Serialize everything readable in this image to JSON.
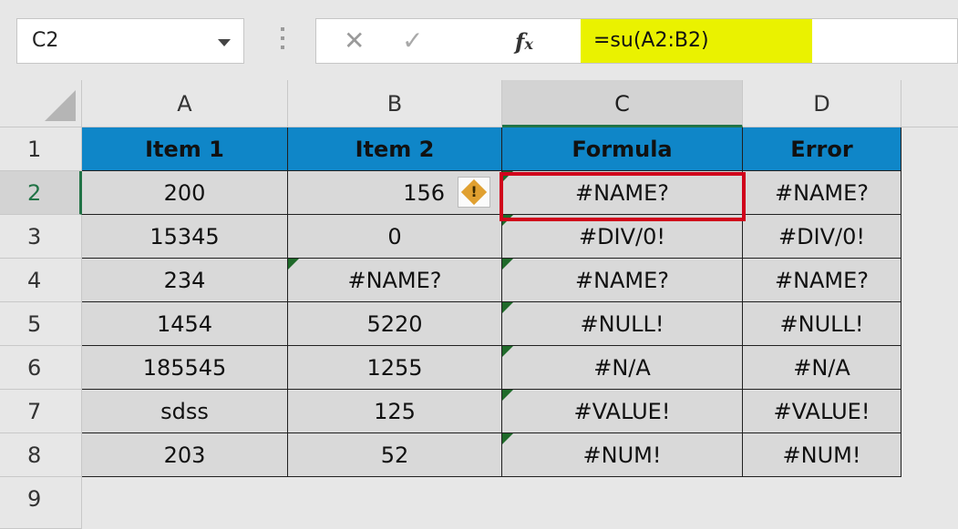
{
  "namebox": {
    "value": "C2"
  },
  "formula_bar": {
    "cancel_icon": "close-icon",
    "enter_icon": "checkmark-icon",
    "fx_label": "fx",
    "formula": "=su(A2:B2)",
    "highlight_color": "#eaf200"
  },
  "columns": [
    "A",
    "B",
    "C",
    "D"
  ],
  "rows": [
    "1",
    "2",
    "3",
    "4",
    "5",
    "6",
    "7",
    "8",
    "9"
  ],
  "header_row": [
    "Item 1",
    "Item 2",
    "Formula",
    "Error"
  ],
  "data_rows": [
    [
      "200",
      "156",
      "#NAME?",
      "#NAME?"
    ],
    [
      "15345",
      "0",
      "#DIV/0!",
      "#DIV/0!"
    ],
    [
      "234",
      "#NAME?",
      "#NAME?",
      "#NAME?"
    ],
    [
      "1454",
      "5220",
      "#NULL!",
      "#NULL!"
    ],
    [
      "185545",
      "1255",
      "#N/A",
      "#N/A"
    ],
    [
      "sdss",
      "125",
      "#VALUE!",
      "#VALUE!"
    ],
    [
      "203",
      "52",
      "#NUM!",
      "#NUM!"
    ]
  ],
  "warning_button": {
    "icon": "warning-icon",
    "glyph": "!"
  },
  "colors": {
    "header_fill": "#0f86c8",
    "cell_fill": "#d9d9d9",
    "selection_border": "#d0021b",
    "active_accent": "#217346"
  }
}
